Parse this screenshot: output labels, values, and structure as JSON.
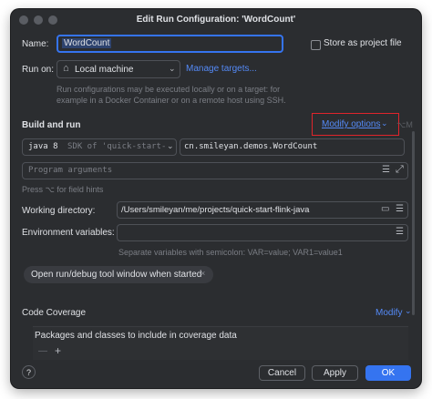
{
  "window": {
    "title": "Edit Run Configuration: 'WordCount'"
  },
  "name": {
    "label": "Name:",
    "value": "WordCount"
  },
  "store": {
    "label": "Store as project file"
  },
  "run_on": {
    "label": "Run on:",
    "target": "Local machine",
    "manage_link": "Manage targets..."
  },
  "run_on_hint": {
    "line1": "Run configurations may be executed locally or on a target: for",
    "line2": "example in a Docker Container or on a remote host using SSH."
  },
  "build_run": {
    "title": "Build and run",
    "modify_options": "Modify options",
    "modify_shortcut": "⌥M",
    "jdk_version": "java 8",
    "jdk_desc": "SDK of 'quick-start-",
    "main_class": "cn.smileyan.demos.WordCount",
    "program_args_placeholder": "Program arguments",
    "field_hint": "Press ⌥ for field hints"
  },
  "working_dir": {
    "label": "Working directory:",
    "value": "/Users/smileyan/me/projects/quick-start-flink-java"
  },
  "env_vars": {
    "label": "Environment variables:",
    "value": "",
    "hint": "Separate variables with semicolon: VAR=value; VAR1=value1"
  },
  "chip": {
    "label": "Open run/debug tool window when started"
  },
  "coverage": {
    "title": "Code Coverage",
    "modify": "Modify",
    "packages_label": "Packages and classes to include in coverage data"
  },
  "footer": {
    "help": "?",
    "cancel": "Cancel",
    "apply": "Apply",
    "ok": "OK"
  },
  "colors": {
    "accent": "#3574f0",
    "link": "#548af7",
    "highlight_box": "#e0242b"
  }
}
